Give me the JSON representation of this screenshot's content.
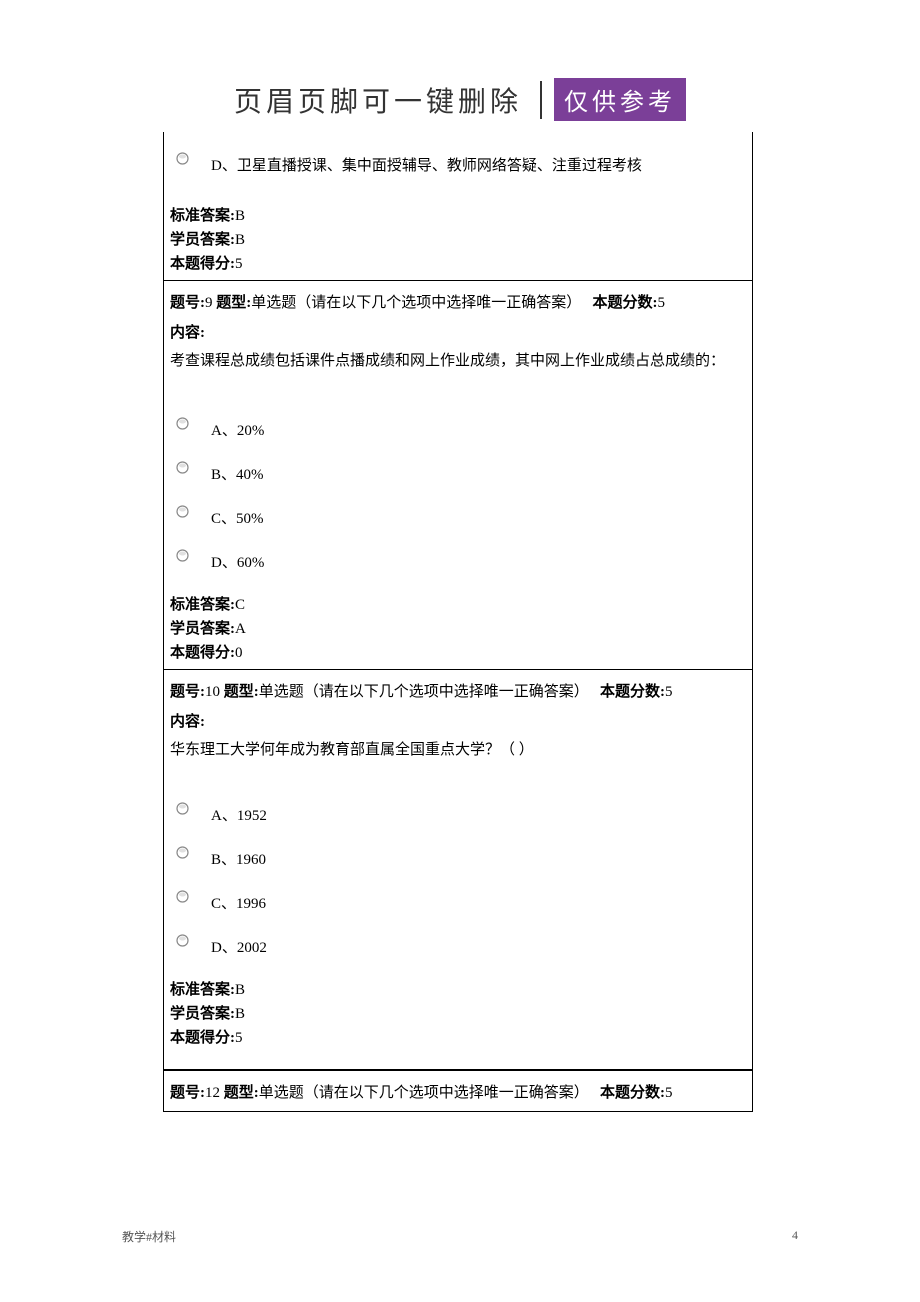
{
  "header": {
    "title": "页眉页脚可一键删除",
    "badge": "仅供参考"
  },
  "q8_partial": {
    "option_d": "D、卫星直播授课、集中面授辅导、教师网络答疑、注重过程考核",
    "std_label": "标准答案:",
    "std_val": "B",
    "stu_label": "学员答案:",
    "stu_val": "B",
    "score_label": "本题得分:",
    "score_val": "5"
  },
  "q9": {
    "num_label": "题号:",
    "num": "9",
    "type_label": "题型:",
    "type_text": "单选题（请在以下几个选项中选择唯一正确答案）",
    "pts_label": "本题分数:",
    "pts": "5",
    "content_label": "内容:",
    "content": "考查课程总成绩包括课件点播成绩和网上作业成绩，其中网上作业成绩占总成绩的：",
    "opt_a": "A、20%",
    "opt_b": "B、40%",
    "opt_c": "C、50%",
    "opt_d": "D、60%",
    "std_label": "标准答案:",
    "std_val": "C",
    "stu_label": "学员答案:",
    "stu_val": "A",
    "score_label": "本题得分:",
    "score_val": "0"
  },
  "q10": {
    "num_label": "题号:",
    "num": "10",
    "type_label": "题型:",
    "type_text": "单选题（请在以下几个选项中选择唯一正确答案）",
    "pts_label": "本题分数:",
    "pts": "5",
    "content_label": "内容:",
    "content": "华东理工大学何年成为教育部直属全国重点大学？（ ）",
    "opt_a": "A、1952",
    "opt_b": "B、1960",
    "opt_c": "C、1996",
    "opt_d": "D、2002",
    "std_label": "标准答案:",
    "std_val": "B",
    "stu_label": "学员答案:",
    "stu_val": "B",
    "score_label": "本题得分:",
    "score_val": "5"
  },
  "q12": {
    "num_label": "题号:",
    "num": "12",
    "type_label": "题型:",
    "type_text": "单选题（请在以下几个选项中选择唯一正确答案）",
    "pts_label": "本题分数:",
    "pts": "5"
  },
  "footer": {
    "text": "教学#材料",
    "page": "4"
  }
}
